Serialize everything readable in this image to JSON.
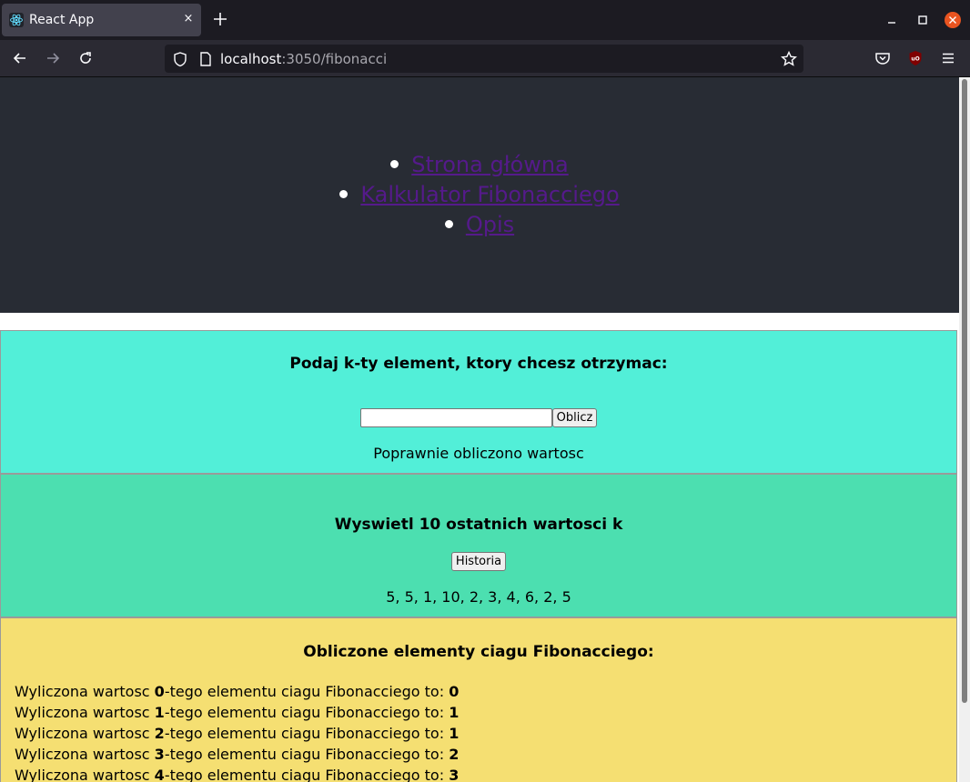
{
  "browser": {
    "tab_title": "React App",
    "tab_close": "×",
    "url_host": "localhost",
    "url_rest": ":3050/fibonacci"
  },
  "nav": {
    "items": [
      {
        "label": "Strona główna"
      },
      {
        "label": "Kalkulator Fibonacciego"
      },
      {
        "label": "Opis"
      }
    ]
  },
  "calc": {
    "heading": "Podaj k-ty element, ktory chcesz otrzymac:",
    "input_value": "",
    "button_label": "Oblicz",
    "status": "Poprawnie obliczono wartosc"
  },
  "history": {
    "heading": "Wyswietl 10 ostatnich wartosci k",
    "button_label": "Historia",
    "values": "5, 5, 1, 10, 2, 3, 4, 6, 2, 5"
  },
  "results": {
    "heading": "Obliczone elementy ciagu Fibonacciego:",
    "prefix": "Wyliczona wartosc ",
    "middle": "-tego elementu ciagu Fibonacciego to: ",
    "rows": [
      {
        "k": "0",
        "value": "0"
      },
      {
        "k": "1",
        "value": "1"
      },
      {
        "k": "2",
        "value": "1"
      },
      {
        "k": "3",
        "value": "2"
      },
      {
        "k": "4",
        "value": "3"
      }
    ]
  },
  "colors": {
    "header_bg": "#282c34",
    "link": "#551a8b",
    "calc_bg": "#52efd8",
    "history_bg": "#4cdfb0",
    "results_bg": "#f5df72"
  }
}
